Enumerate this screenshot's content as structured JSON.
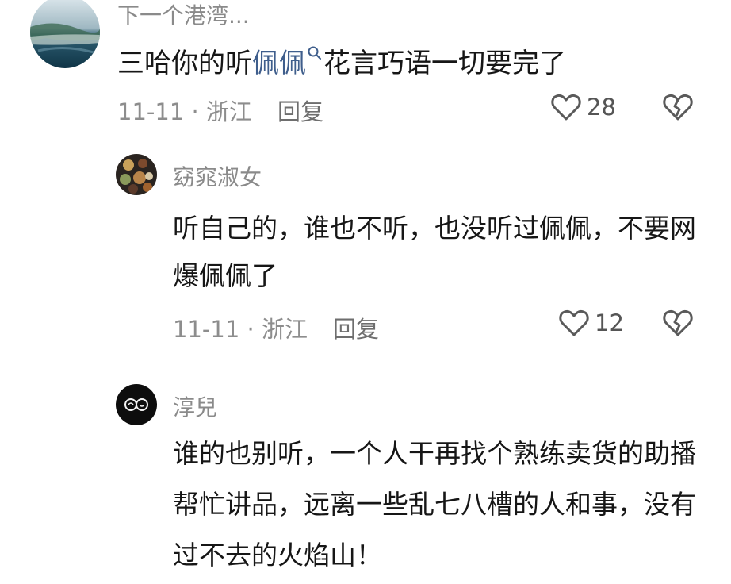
{
  "comments": [
    {
      "username": "下一个港湾...",
      "text_before": "三哈你的听",
      "text_highlight": "佩佩",
      "text_after": "花言巧语一切要完了",
      "date": "11-11",
      "location": "浙江",
      "reply_label": "回复",
      "likes": "28"
    },
    {
      "username": "窈窕淑女",
      "text": "听自己的，谁也不听，也没听过佩佩，不要网爆佩佩了",
      "date": "11-11",
      "location": "浙江",
      "reply_label": "回复",
      "likes": "12"
    },
    {
      "username": "淳兒",
      "text": "谁的也别听，一个人干再找个熟练卖货的助播帮忙讲品，远离一些乱七八槽的人和事，没有过不去的火焰山！"
    }
  ],
  "meta_separator": "·"
}
